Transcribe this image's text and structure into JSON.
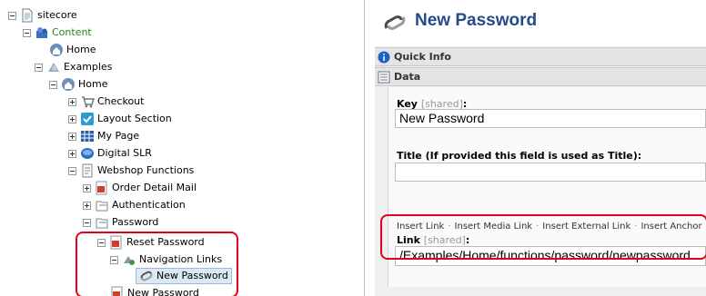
{
  "tree": {
    "items": [
      {
        "label": "sitecore",
        "icon": "page-icon"
      },
      {
        "label": "Content",
        "icon": "content-folder-icon"
      },
      {
        "label": "Home",
        "icon": "home-icon"
      },
      {
        "label": "Examples",
        "icon": "examples-icon"
      },
      {
        "label": "Home",
        "icon": "home-icon"
      },
      {
        "label": "Checkout",
        "icon": "cart-icon"
      },
      {
        "label": "Layout Section",
        "icon": "layout-icon"
      },
      {
        "label": "My Page",
        "icon": "grid-page-icon"
      },
      {
        "label": "Digital SLR",
        "icon": "camera-icon"
      },
      {
        "label": "Webshop Functions",
        "icon": "functions-icon"
      },
      {
        "label": "Order Detail Mail",
        "icon": "mail-icon"
      },
      {
        "label": "Authentication",
        "icon": "folder-icon"
      },
      {
        "label": "Password",
        "icon": "folder-icon"
      },
      {
        "label": "Reset Password",
        "icon": "reset-password-icon"
      },
      {
        "label": "Navigation Links",
        "icon": "nav-links-icon"
      },
      {
        "label": "New Password",
        "icon": "link-icon"
      },
      {
        "label": "New Password",
        "icon": "new-password-icon"
      }
    ]
  },
  "editor": {
    "title": "New Password",
    "sections": {
      "quick_info": "Quick Info",
      "data": "Data"
    },
    "fields": {
      "key": {
        "label": "Key",
        "shared": "[shared]",
        "suffix": ":",
        "value": "New Password"
      },
      "title": {
        "label": "Title (If provided this field is used as Title):",
        "value": ""
      },
      "link": {
        "label": "Link",
        "shared": "[shared]",
        "suffix": ":",
        "value": "/Examples/Home/functions/password/newpassword"
      }
    },
    "link_toolbar": [
      "Insert Link",
      "Insert Media Link",
      "Insert External Link",
      "Insert Anchor"
    ],
    "separator": "·"
  },
  "colors": {
    "highlight": "#e3001b",
    "title": "#234a8a",
    "content_label": "#2a7d1e"
  }
}
